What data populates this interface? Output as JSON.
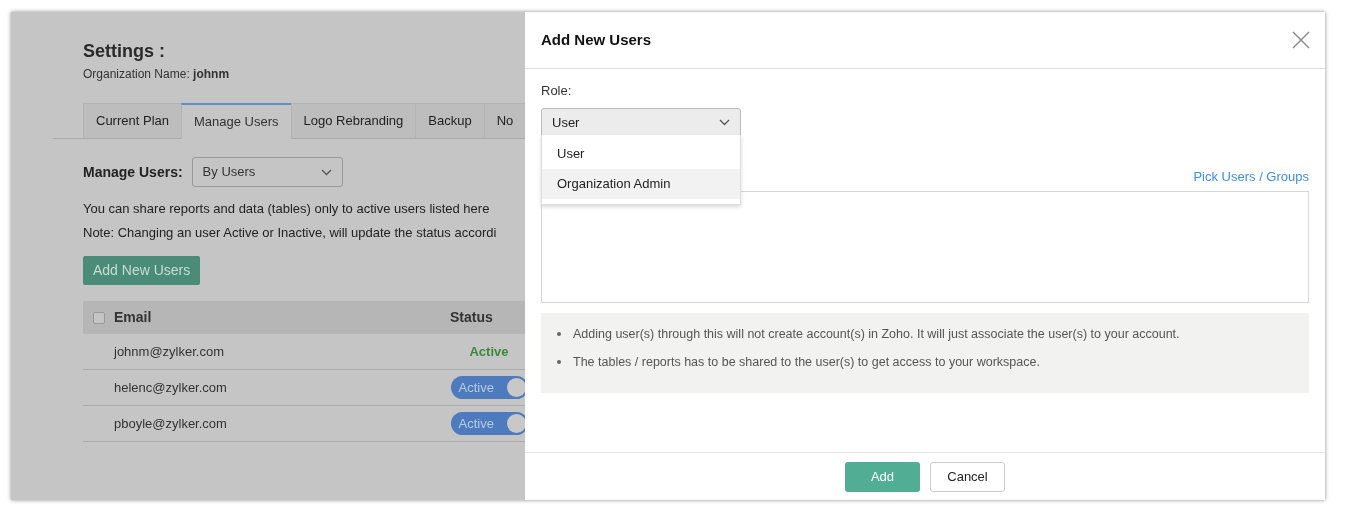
{
  "settings": {
    "title": "Settings :",
    "org_label": "Organization Name:",
    "org_name": "johnm"
  },
  "tabs": [
    {
      "label": "Current Plan",
      "selected": false
    },
    {
      "label": "Manage Users",
      "selected": true
    },
    {
      "label": "Logo Rebranding",
      "selected": false
    },
    {
      "label": "Backup",
      "selected": false
    },
    {
      "label": "No",
      "selected": false
    }
  ],
  "manage": {
    "label": "Manage Users:",
    "value": "By Users"
  },
  "notes": [
    "You can share reports and data (tables) only to active users listed here",
    "Note: Changing an user Active or Inactive, will update the status accordi"
  ],
  "add_button": "Add New Users",
  "table": {
    "select_all_checked": false,
    "columns": [
      "Email",
      "Status"
    ],
    "rows": [
      {
        "email": "johnm@zylker.com",
        "status": "Active",
        "kind": "text"
      },
      {
        "email": "helenc@zylker.com",
        "status": "Active",
        "kind": "toggle",
        "on": true
      },
      {
        "email": "pboyle@zylker.com",
        "status": "Active",
        "kind": "toggle",
        "on": true
      }
    ]
  },
  "dialog": {
    "title": "Add New Users",
    "role_label": "Role:",
    "role_value": "User",
    "role_options": [
      {
        "label": "User",
        "highlighted": false
      },
      {
        "label": "Organization Admin",
        "highlighted": true
      }
    ],
    "pick_link": "Pick Users / Groups",
    "info": [
      "Adding user(s) through this will not create account(s) in Zoho. It will just associate the user(s) to your account.",
      "The tables / reports has to be shared to the user(s) to get access to your workspace."
    ],
    "buttons": [
      {
        "label": "Add",
        "kind": "primary"
      },
      {
        "label": "Cancel",
        "kind": "secondary"
      }
    ]
  }
}
